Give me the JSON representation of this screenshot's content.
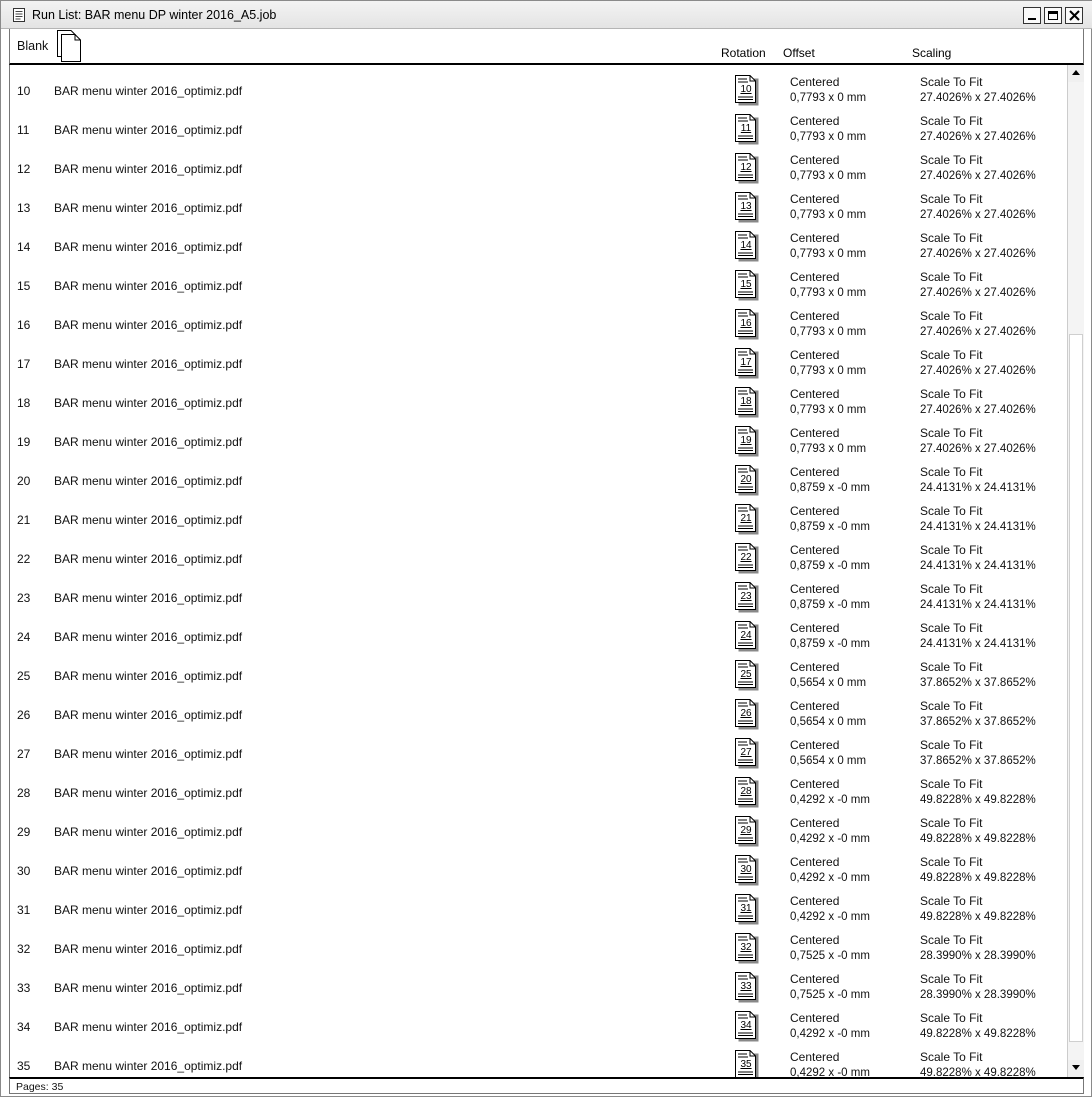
{
  "window": {
    "title": "Run List:  BAR menu DP winter 2016_A5.job",
    "title_icon": "document-list-icon",
    "buttons": [
      "minimize",
      "maximize",
      "close"
    ]
  },
  "header": {
    "blank_label": "Blank",
    "blank_icon": "blank-page-icon",
    "columns": {
      "rotation": "Rotation",
      "offset": "Offset",
      "scaling": "Scaling"
    }
  },
  "rows": [
    {
      "num": "10",
      "name": "BAR menu winter 2016_optimiz.pdf",
      "page": "10",
      "offset_mode": "Centered",
      "offset": "0,7793 x 0 mm",
      "scale_mode": "Scale To Fit",
      "scale": "27.4026% x 27.4026%"
    },
    {
      "num": "11",
      "name": "BAR menu winter 2016_optimiz.pdf",
      "page": "11",
      "offset_mode": "Centered",
      "offset": "0,7793 x 0 mm",
      "scale_mode": "Scale To Fit",
      "scale": "27.4026% x 27.4026%"
    },
    {
      "num": "12",
      "name": "BAR menu winter 2016_optimiz.pdf",
      "page": "12",
      "offset_mode": "Centered",
      "offset": "0,7793 x 0 mm",
      "scale_mode": "Scale To Fit",
      "scale": "27.4026% x 27.4026%"
    },
    {
      "num": "13",
      "name": "BAR menu winter 2016_optimiz.pdf",
      "page": "13",
      "offset_mode": "Centered",
      "offset": "0,7793 x 0 mm",
      "scale_mode": "Scale To Fit",
      "scale": "27.4026% x 27.4026%"
    },
    {
      "num": "14",
      "name": "BAR menu winter 2016_optimiz.pdf",
      "page": "14",
      "offset_mode": "Centered",
      "offset": "0,7793 x 0 mm",
      "scale_mode": "Scale To Fit",
      "scale": "27.4026% x 27.4026%"
    },
    {
      "num": "15",
      "name": "BAR menu winter 2016_optimiz.pdf",
      "page": "15",
      "offset_mode": "Centered",
      "offset": "0,7793 x 0 mm",
      "scale_mode": "Scale To Fit",
      "scale": "27.4026% x 27.4026%"
    },
    {
      "num": "16",
      "name": "BAR menu winter 2016_optimiz.pdf",
      "page": "16",
      "offset_mode": "Centered",
      "offset": "0,7793 x 0 mm",
      "scale_mode": "Scale To Fit",
      "scale": "27.4026% x 27.4026%"
    },
    {
      "num": "17",
      "name": "BAR menu winter 2016_optimiz.pdf",
      "page": "17",
      "offset_mode": "Centered",
      "offset": "0,7793 x 0 mm",
      "scale_mode": "Scale To Fit",
      "scale": "27.4026% x 27.4026%"
    },
    {
      "num": "18",
      "name": "BAR menu winter 2016_optimiz.pdf",
      "page": "18",
      "offset_mode": "Centered",
      "offset": "0,7793 x 0 mm",
      "scale_mode": "Scale To Fit",
      "scale": "27.4026% x 27.4026%"
    },
    {
      "num": "19",
      "name": "BAR menu winter 2016_optimiz.pdf",
      "page": "19",
      "offset_mode": "Centered",
      "offset": "0,7793 x 0 mm",
      "scale_mode": "Scale To Fit",
      "scale": "27.4026% x 27.4026%"
    },
    {
      "num": "20",
      "name": "BAR menu winter 2016_optimiz.pdf",
      "page": "20",
      "offset_mode": "Centered",
      "offset": "0,8759 x -0 mm",
      "scale_mode": "Scale To Fit",
      "scale": "24.4131% x 24.4131%"
    },
    {
      "num": "21",
      "name": "BAR menu winter 2016_optimiz.pdf",
      "page": "21",
      "offset_mode": "Centered",
      "offset": "0,8759 x -0 mm",
      "scale_mode": "Scale To Fit",
      "scale": "24.4131% x 24.4131%"
    },
    {
      "num": "22",
      "name": "BAR menu winter 2016_optimiz.pdf",
      "page": "22",
      "offset_mode": "Centered",
      "offset": "0,8759 x -0 mm",
      "scale_mode": "Scale To Fit",
      "scale": "24.4131% x 24.4131%"
    },
    {
      "num": "23",
      "name": "BAR menu winter 2016_optimiz.pdf",
      "page": "23",
      "offset_mode": "Centered",
      "offset": "0,8759 x -0 mm",
      "scale_mode": "Scale To Fit",
      "scale": "24.4131% x 24.4131%"
    },
    {
      "num": "24",
      "name": "BAR menu winter 2016_optimiz.pdf",
      "page": "24",
      "offset_mode": "Centered",
      "offset": "0,8759 x -0 mm",
      "scale_mode": "Scale To Fit",
      "scale": "24.4131% x 24.4131%"
    },
    {
      "num": "25",
      "name": "BAR menu winter 2016_optimiz.pdf",
      "page": "25",
      "offset_mode": "Centered",
      "offset": "0,5654 x 0 mm",
      "scale_mode": "Scale To Fit",
      "scale": "37.8652% x 37.8652%"
    },
    {
      "num": "26",
      "name": "BAR menu winter 2016_optimiz.pdf",
      "page": "26",
      "offset_mode": "Centered",
      "offset": "0,5654 x 0 mm",
      "scale_mode": "Scale To Fit",
      "scale": "37.8652% x 37.8652%"
    },
    {
      "num": "27",
      "name": "BAR menu winter 2016_optimiz.pdf",
      "page": "27",
      "offset_mode": "Centered",
      "offset": "0,5654 x 0 mm",
      "scale_mode": "Scale To Fit",
      "scale": "37.8652% x 37.8652%"
    },
    {
      "num": "28",
      "name": "BAR menu winter 2016_optimiz.pdf",
      "page": "28",
      "offset_mode": "Centered",
      "offset": "0,4292 x -0 mm",
      "scale_mode": "Scale To Fit",
      "scale": "49.8228% x 49.8228%"
    },
    {
      "num": "29",
      "name": "BAR menu winter 2016_optimiz.pdf",
      "page": "29",
      "offset_mode": "Centered",
      "offset": "0,4292 x -0 mm",
      "scale_mode": "Scale To Fit",
      "scale": "49.8228% x 49.8228%"
    },
    {
      "num": "30",
      "name": "BAR menu winter 2016_optimiz.pdf",
      "page": "30",
      "offset_mode": "Centered",
      "offset": "0,4292 x -0 mm",
      "scale_mode": "Scale To Fit",
      "scale": "49.8228% x 49.8228%"
    },
    {
      "num": "31",
      "name": "BAR menu winter 2016_optimiz.pdf",
      "page": "31",
      "offset_mode": "Centered",
      "offset": "0,4292 x -0 mm",
      "scale_mode": "Scale To Fit",
      "scale": "49.8228% x 49.8228%"
    },
    {
      "num": "32",
      "name": "BAR menu winter 2016_optimiz.pdf",
      "page": "32",
      "offset_mode": "Centered",
      "offset": "0,7525 x -0 mm",
      "scale_mode": "Scale To Fit",
      "scale": "28.3990% x 28.3990%"
    },
    {
      "num": "33",
      "name": "BAR menu winter 2016_optimiz.pdf",
      "page": "33",
      "offset_mode": "Centered",
      "offset": "0,7525 x -0 mm",
      "scale_mode": "Scale To Fit",
      "scale": "28.3990% x 28.3990%"
    },
    {
      "num": "34",
      "name": "BAR menu winter 2016_optimiz.pdf",
      "page": "34",
      "offset_mode": "Centered",
      "offset": "0,4292 x -0 mm",
      "scale_mode": "Scale To Fit",
      "scale": "49.8228% x 49.8228%"
    },
    {
      "num": "35",
      "name": "BAR menu winter 2016_optimiz.pdf",
      "page": "35",
      "offset_mode": "Centered",
      "offset": "0,4292 x -0 mm",
      "scale_mode": "Scale To Fit",
      "scale": "49.8228% x 49.8228%"
    }
  ],
  "page_icon": "page-thumbnail-icon",
  "status": {
    "text": "Pages: 35"
  }
}
